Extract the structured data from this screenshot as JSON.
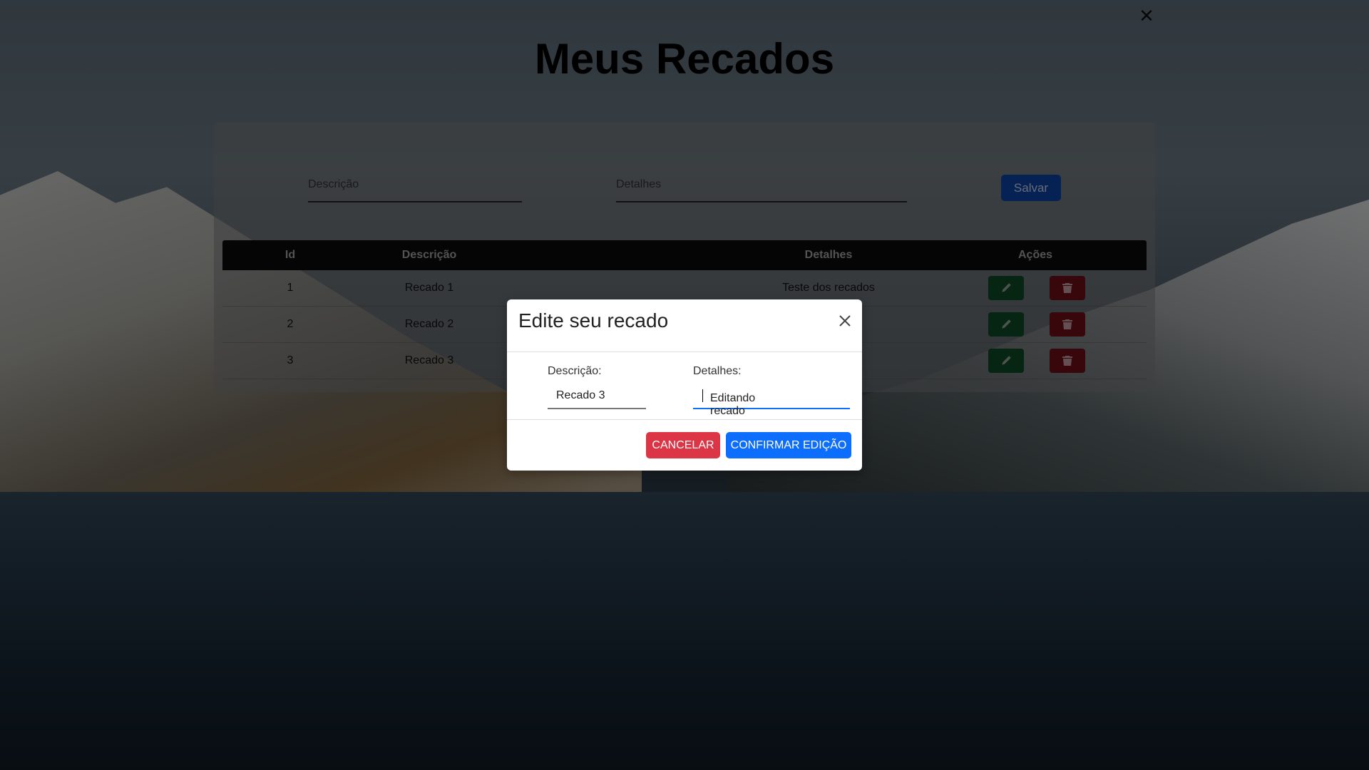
{
  "page": {
    "title": "Meus Recados"
  },
  "form": {
    "descricao_placeholder": "Descrição",
    "detalhes_placeholder": "Detalhes",
    "save_label": "Salvar"
  },
  "table": {
    "headers": {
      "id": "Id",
      "descricao": "Descrição",
      "detalhes": "Detalhes",
      "acoes": "Ações"
    },
    "rows": [
      {
        "id": "1",
        "descricao": "Recado 1",
        "detalhes": "Teste dos recados"
      },
      {
        "id": "2",
        "descricao": "Recado 2",
        "detalhes": ""
      },
      {
        "id": "3",
        "descricao": "Recado 3",
        "detalhes": ""
      }
    ]
  },
  "modal": {
    "title": "Edite seu recado",
    "descricao_label": "Descrição:",
    "descricao_value": "Recado 3",
    "detalhes_label": "Detalhes:",
    "detalhes_value": "Editando recado",
    "cancel_label": "CANCELAR",
    "confirm_label": "CONFIRMAR EDIÇÃO"
  },
  "icons": {
    "edit": "pencil-icon",
    "delete": "trash-icon",
    "close": "close-icon"
  },
  "colors": {
    "primary": "#0d6efd",
    "danger": "#dc3545",
    "success": "#198754"
  }
}
